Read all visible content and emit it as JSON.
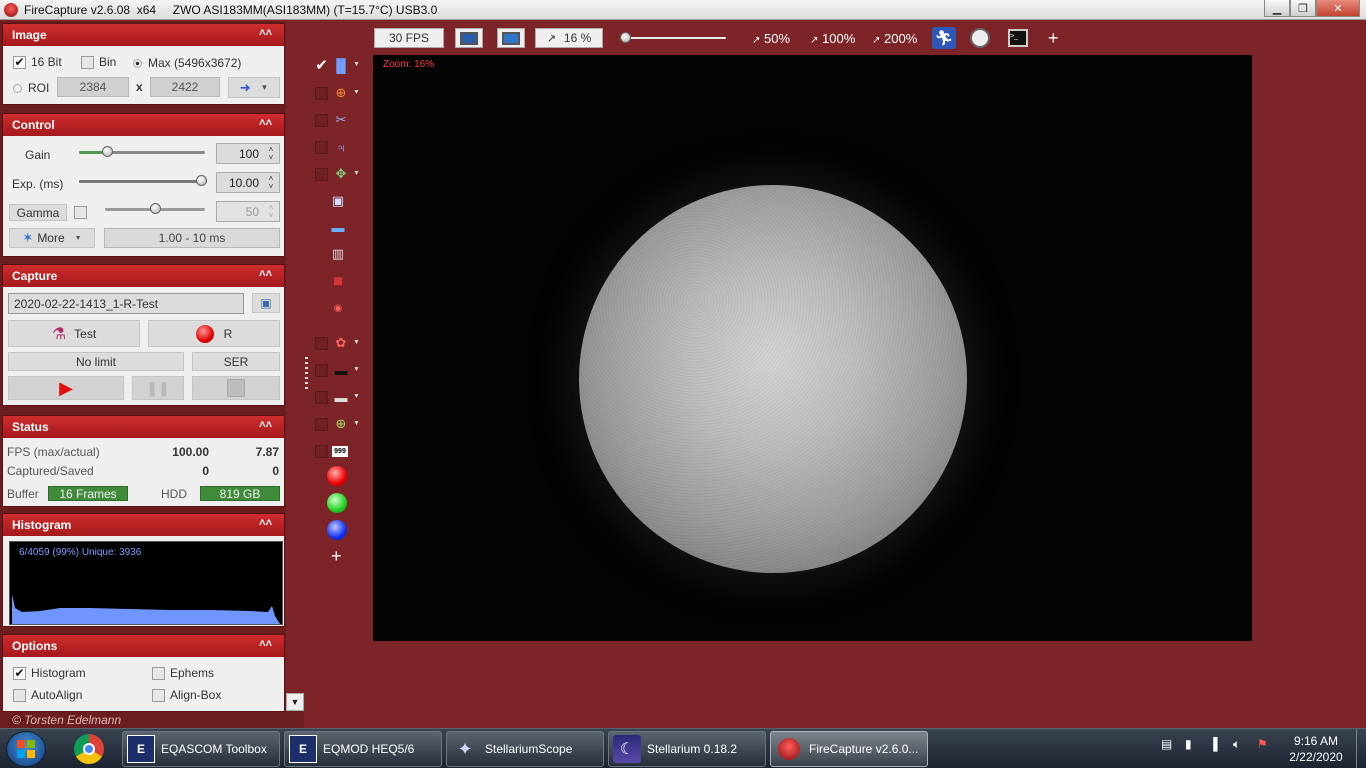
{
  "window": {
    "title": "FireCapture v2.6.08  x64     ZWO ASI183MM(ASI183MM) (T=15.7°C) USB3.0"
  },
  "image_panel": {
    "title": "Image",
    "bit16_label": "16 Bit",
    "bin_label": "Bin",
    "max_label": "Max (5496x3672)",
    "roi_label": "ROI",
    "roi_width": "2384",
    "roi_x": "x",
    "roi_height": "2422"
  },
  "control_panel": {
    "title": "Control",
    "gain_label": "Gain",
    "gain_value": "100",
    "gain_level": 0.2,
    "exp_label": "Exp. (ms)",
    "exp_value": "10.00",
    "exp_level": 1.0,
    "gamma_label": "Gamma",
    "gamma_value": "50",
    "gamma_level": 0.5,
    "more_label": "More",
    "range_label": "1.00 - 10 ms"
  },
  "capture_panel": {
    "title": "Capture",
    "filename": "2020-02-22-1413_1-R-Test",
    "test_label": "Test",
    "filter_label": "R",
    "limit_label": "No limit",
    "format_label": "SER"
  },
  "status_panel": {
    "title": "Status",
    "fps_label": "FPS (max/actual)",
    "fps_max": "100.00",
    "fps_actual": "7.87",
    "captured_label": "Captured/Saved",
    "captured": "0",
    "saved": "0",
    "buffer_label": "Buffer",
    "buffer_value": "16 Frames",
    "hdd_label": "HDD",
    "hdd_value": "819 GB"
  },
  "histogram_panel": {
    "title": "Histogram",
    "info": "6/4059 (99%)  Unique: 3936"
  },
  "options_panel": {
    "title": "Options",
    "histogram_label": "Histogram",
    "ephems_label": "Ephems",
    "autoalign_label": "AutoAlign",
    "alignbox_label": "Align-Box"
  },
  "copyright": "© Torsten Edelmann",
  "toolbar": {
    "fps": "30 FPS",
    "zoom_value": "16 %",
    "zoom_50": "50%",
    "zoom_100": "100%",
    "zoom_200": "200%",
    "plus": "+"
  },
  "preview": {
    "zoom_text": "Zoom: 16%"
  },
  "sidetools": {
    "counter_icon_text": "999",
    "plus": "+"
  },
  "taskbar": {
    "tasks": [
      {
        "label": "EQASCOM Toolbox"
      },
      {
        "label": "EQMOD HEQ5/6"
      },
      {
        "label": "StellariumScope"
      },
      {
        "label": "Stellarium 0.18.2"
      },
      {
        "label": "FireCapture v2.6.0..."
      }
    ],
    "time": "9:16 AM",
    "date": "2/22/2020"
  },
  "colors": {
    "background": "#7d2428",
    "panel_header": "#c0262a",
    "green_value": "#3f8b3a",
    "histogram_fill": "#6f95ff",
    "zoom_text": "#ff3b3b"
  }
}
